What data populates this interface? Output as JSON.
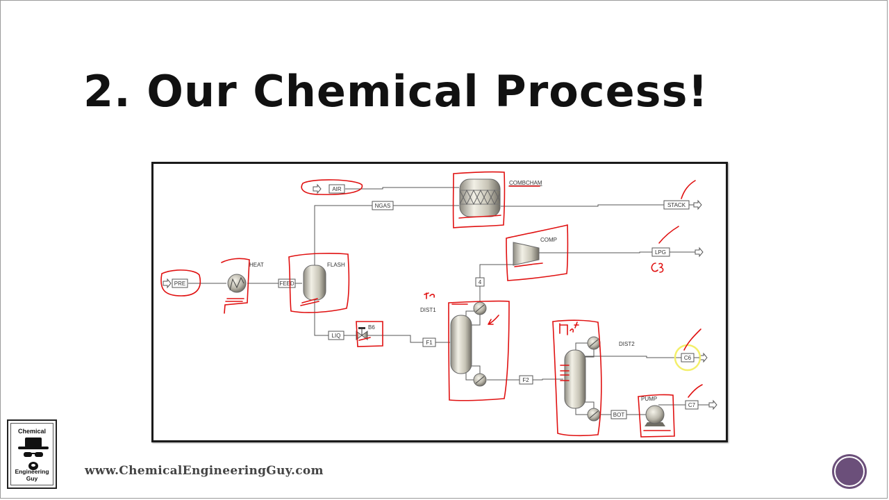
{
  "slide": {
    "title": "2. Our Chemical Process!",
    "website": "www.ChemicalEngineeringGuy.com",
    "logo": {
      "top_text": "Chemical",
      "bottom_text": "Engineering Guy",
      "icon": "heisenberg-hat-glasses-beard-icon"
    },
    "nav_button_icon": "circle-nav-icon"
  },
  "diagram": {
    "blocks": {
      "combchamber": "COMBCHAM",
      "compressor": "COMP",
      "heater": "HEAT",
      "flash": "FLASH",
      "valve": "B6",
      "dist1": "DIST1",
      "dist2": "DIST2",
      "pump": "PUMP"
    },
    "streams": {
      "air": "AIR",
      "ngas": "NGAS",
      "stack": "STACK",
      "lpg": "LPG",
      "pre": "PRE",
      "feed": "FEED",
      "liq": "LIQ",
      "s4": "4",
      "f1": "F1",
      "f2": "F2",
      "c6": "C6",
      "bot": "BOT",
      "c7": "C7"
    },
    "annotations": {
      "lpg_note": "C3",
      "dist1_note": "RT",
      "dist2_note": "1st",
      "highlight": "C6",
      "ink_color": "#e01010",
      "highlight_color": "#f3ef6a"
    }
  }
}
